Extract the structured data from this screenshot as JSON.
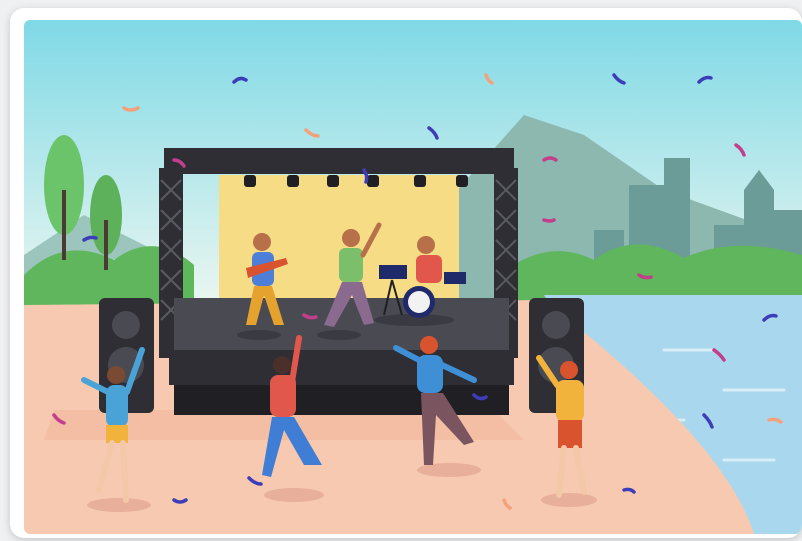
{
  "illustration": {
    "subject": "outdoor-concert-stage",
    "colors": {
      "sky_top": "#82dbe6",
      "sky_bottom": "#e9f7f3",
      "ground": "#f6c9b2",
      "water": "#a9d9ee",
      "stage_back": "#f6dd84",
      "stage_frame": "#2d2d33",
      "tree_green": "#5cb85c",
      "hill": "#7cb3a8",
      "city": "#6a9b97"
    }
  }
}
